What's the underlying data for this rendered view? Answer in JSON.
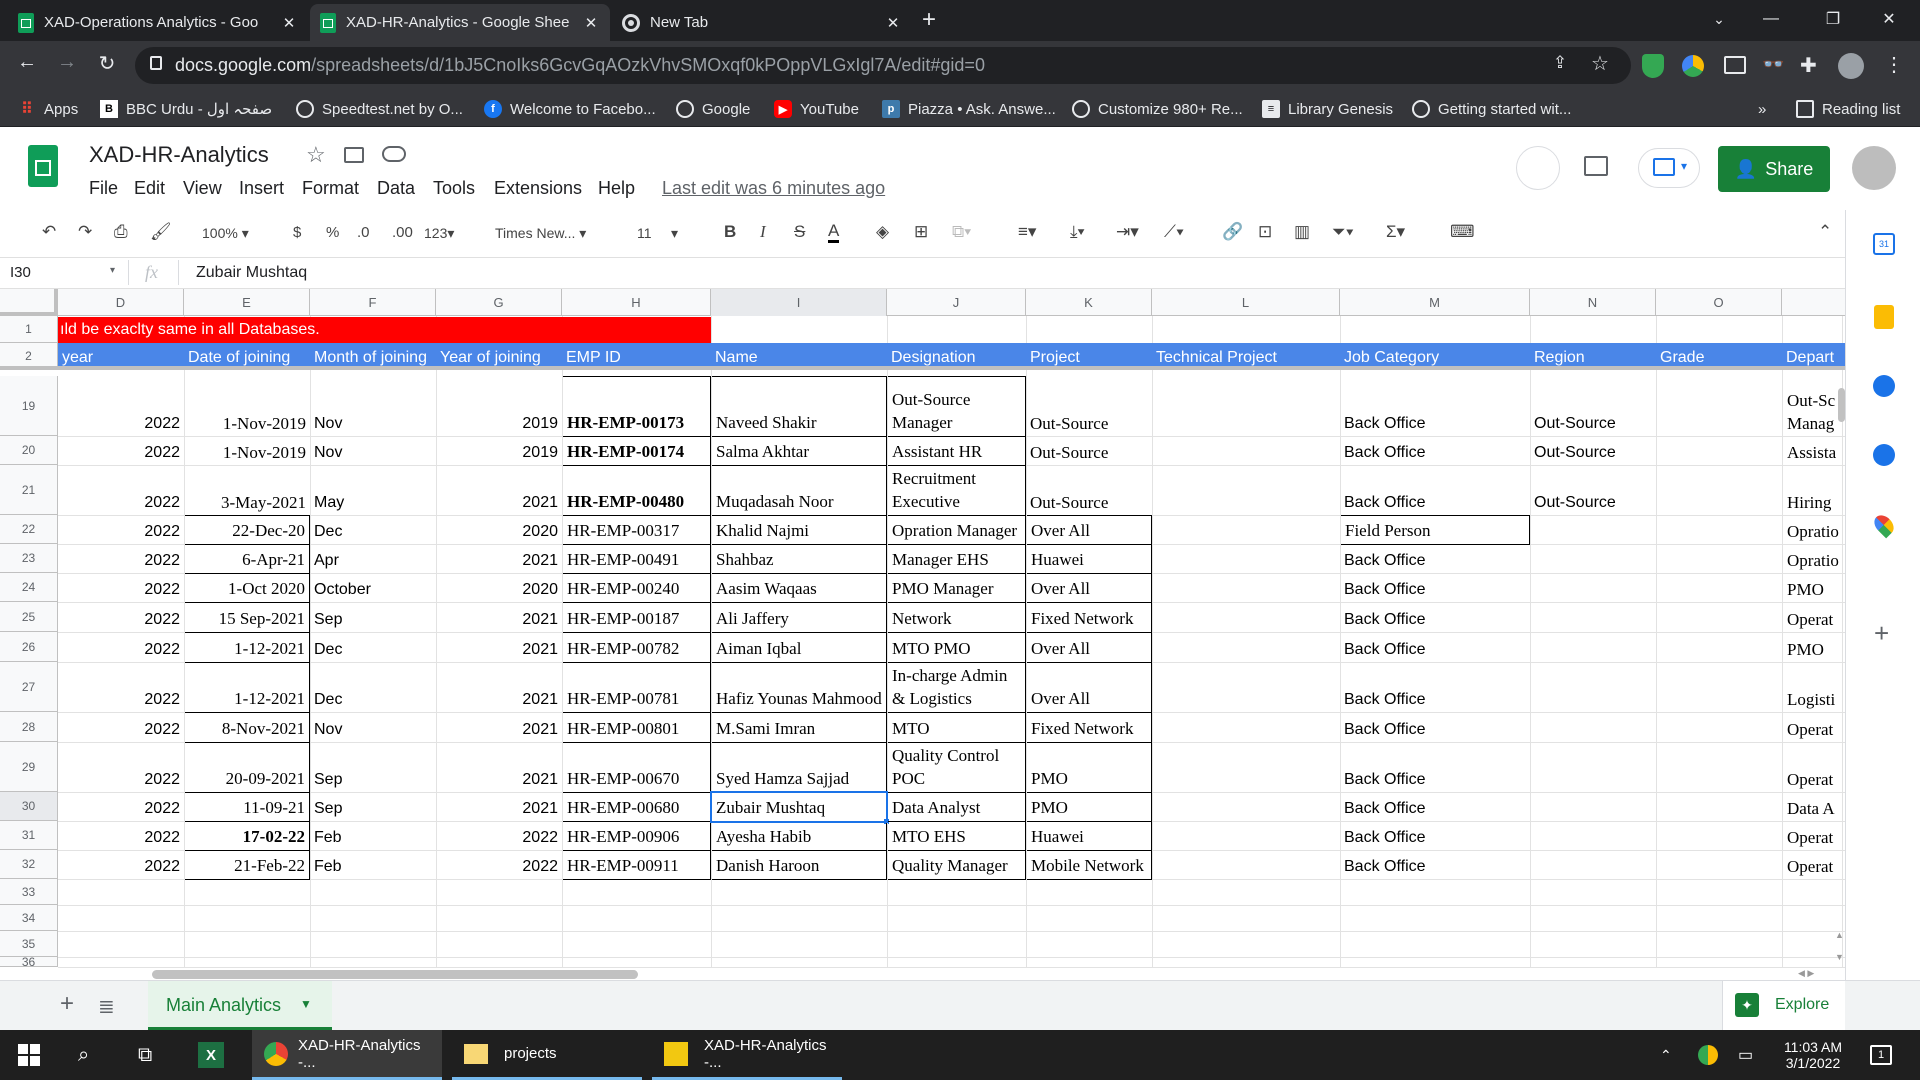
{
  "browser": {
    "tabs": [
      {
        "title": "XAD-Operations Analytics - Goo",
        "active": false
      },
      {
        "title": "XAD-HR-Analytics - Google Shee",
        "active": true
      },
      {
        "title": "New Tab",
        "active": false
      }
    ],
    "url_host": "docs.google.com",
    "url_path": "/spreadsheets/d/1bJ5CnoIks6GcvGqAOzkVhvSMOxqf0kPOppVLGxIgl7A/edit#gid=0",
    "bookmarks": [
      "Apps",
      "BBC Urdu - صفحہ اول",
      "Speedtest.net by O...",
      "Welcome to Facebo...",
      "Google",
      "YouTube",
      "Piazza • Ask. Answe...",
      "Customize 980+ Re...",
      "Library Genesis",
      "Getting started wit..."
    ],
    "more_bookmarks": "»",
    "reading_list": "Reading list"
  },
  "doc": {
    "title": "XAD-HR-Analytics",
    "menu": [
      "File",
      "Edit",
      "View",
      "Insert",
      "Format",
      "Data",
      "Tools",
      "Extensions",
      "Help"
    ],
    "last_edit": "Last edit was 6 minutes ago",
    "share_label": "Share"
  },
  "toolbar": {
    "zoom": "100%",
    "currency": "$",
    "percent": "%",
    "dec_less": ".0",
    "dec_more": ".00",
    "more_formats": "123",
    "font": "Times New...",
    "font_size": "11"
  },
  "formula_bar": {
    "cell_ref": "I30",
    "fx": "fx",
    "value": "Zubair Mushtaq"
  },
  "columns": [
    "D",
    "E",
    "F",
    "G",
    "H",
    "I",
    "J",
    "K",
    "L",
    "M",
    "N",
    "O"
  ],
  "banner_text": "ıld be exaclty same in all Databases.",
  "header_row": [
    "year",
    "Date of joining",
    "Month of joining",
    "Year of joining",
    "EMP ID",
    "Name",
    "Designation",
    "Project",
    "Technical Project",
    "Job Category",
    "Region",
    "Grade",
    "Depart"
  ],
  "rows": [
    {
      "n": "19",
      "year": "2022",
      "doj": "1-Nov-2019",
      "month": "Nov",
      "yoj": "2019",
      "emp": "HR-EMP-00173",
      "name": "Naveed Shakir",
      "desig": "Out-Source Manager",
      "project": "Out-Source",
      "job": "Back Office",
      "region": "Out-Source",
      "dept": "Out-Sc Manag"
    },
    {
      "n": "20",
      "year": "2022",
      "doj": "1-Nov-2019",
      "month": "Nov",
      "yoj": "2019",
      "emp": "HR-EMP-00174",
      "name": "Salma Akhtar",
      "desig": "Assistant HR",
      "project": "Out-Source",
      "job": "Back Office",
      "region": "Out-Source",
      "dept": "Assista"
    },
    {
      "n": "21",
      "year": "2022",
      "doj": "3-May-2021",
      "month": "May",
      "yoj": "2021",
      "emp": "HR-EMP-00480",
      "name": "Muqadasah Noor",
      "desig": "Recruitment Executive",
      "project": "Out-Source",
      "job": "Back Office",
      "region": "Out-Source",
      "dept": "Hiring"
    },
    {
      "n": "22",
      "year": "2022",
      "doj": "22-Dec-20",
      "month": "Dec",
      "yoj": "2020",
      "emp": "HR-EMP-00317",
      "name": "Khalid Najmi",
      "desig": "Opration Manager",
      "project": "Over All",
      "job": "Field Person",
      "region": "",
      "dept": "Opratio"
    },
    {
      "n": "23",
      "year": "2022",
      "doj": "6-Apr-21",
      "month": "Apr",
      "yoj": "2021",
      "emp": "HR-EMP-00491",
      "name": "Shahbaz",
      "desig": "Manager EHS",
      "project": "Huawei",
      "job": "Back Office",
      "region": "",
      "dept": "Opratio"
    },
    {
      "n": "24",
      "year": "2022",
      "doj": "1-Oct 2020",
      "month": "October",
      "yoj": "2020",
      "emp": "HR-EMP-00240",
      "name": "Aasim Waqaas",
      "desig": "PMO Manager",
      "project": "Over All",
      "job": "Back Office",
      "region": "",
      "dept": "PMO"
    },
    {
      "n": "25",
      "year": "2022",
      "doj": "15 Sep-2021",
      "month": "Sep",
      "yoj": "2021",
      "emp": "HR-EMP-00187",
      "name": "Ali Jaffery",
      "desig": "PM Fixed Network",
      "project": "Fixed Network",
      "job": "Back Office",
      "region": "",
      "dept": "Operat"
    },
    {
      "n": "26",
      "year": "2022",
      "doj": "1-12-2021",
      "month": "Dec",
      "yoj": "2021",
      "emp": "HR-EMP-00782",
      "name": "Aiman Iqbal",
      "desig": "MTO PMO",
      "project": "Over All",
      "job": "Back Office",
      "region": "",
      "dept": "PMO"
    },
    {
      "n": "27",
      "year": "2022",
      "doj": "1-12-2021",
      "month": "Dec",
      "yoj": "2021",
      "emp": "HR-EMP-00781",
      "name": "Hafiz Younas Mahmood",
      "desig": "In-charge Admin & Logistics",
      "project": "Over All",
      "job": "Back Office",
      "region": "",
      "dept": "Logisti"
    },
    {
      "n": "28",
      "year": "2022",
      "doj": "8-Nov-2021",
      "month": "Nov",
      "yoj": "2021",
      "emp": "HR-EMP-00801",
      "name": "M.Sami Imran",
      "desig": "MTO",
      "project": "Fixed Network",
      "job": "Back Office",
      "region": "",
      "dept": "Operat"
    },
    {
      "n": "29",
      "year": "2022",
      "doj": "20-09-2021",
      "month": "Sep",
      "yoj": "2021",
      "emp": "HR-EMP-00670",
      "name": "Syed Hamza Sajjad",
      "desig": "Quality Control POC",
      "project": "PMO",
      "job": "Back Office",
      "region": "",
      "dept": "Operat"
    },
    {
      "n": "30",
      "year": "2022",
      "doj": "11-09-21",
      "month": "Sep",
      "yoj": "2021",
      "emp": "HR-EMP-00680",
      "name": "Zubair Mushtaq",
      "desig": "Data Analyst",
      "project": "PMO",
      "job": "Back Office",
      "region": "",
      "dept": "Data A"
    },
    {
      "n": "31",
      "year": "2022",
      "doj": "17-02-22",
      "month": "Feb",
      "yoj": "2022",
      "emp": "HR-EMP-00906",
      "name": "Ayesha Habib",
      "desig": "MTO EHS",
      "project": "Huawei",
      "job": "Back Office",
      "region": "",
      "dept": "Operat"
    },
    {
      "n": "32",
      "year": "2022",
      "doj": "21-Feb-22",
      "month": "Feb",
      "yoj": "2022",
      "emp": "HR-EMP-00911",
      "name": "Danish Haroon",
      "desig": "Quality Manager",
      "project": "Mobile Network",
      "job": "Back Office",
      "region": "",
      "dept": "Operat"
    }
  ],
  "empty_rows": [
    "33",
    "34",
    "35",
    "36"
  ],
  "sheet_tab": "Main Analytics",
  "explore_label": "Explore",
  "taskbar": {
    "items": [
      "XAD-HR-Analytics -...",
      "projects",
      "XAD-HR-Analytics -..."
    ],
    "time": "11:03 AM",
    "date": "3/1/2022",
    "notification_count": "1"
  },
  "colors": {
    "banner_red": "#ff0000",
    "header_blue": "#4a86e8",
    "sheets_green": "#188038"
  }
}
